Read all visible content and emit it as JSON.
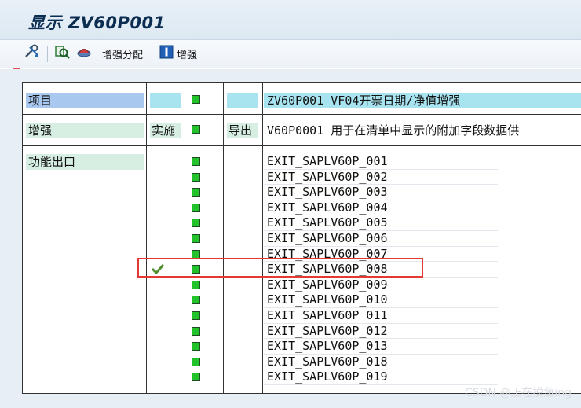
{
  "window": {
    "title": "显示 ZV60P001"
  },
  "toolbar": {
    "items": [
      {
        "icon": "config-tools-icon"
      },
      {
        "icon": "where-used-icon"
      },
      {
        "icon": "transport-icon"
      },
      {
        "label": "增强分配",
        "icon": ""
      },
      {
        "label": "增强",
        "icon": "info-icon"
      }
    ]
  },
  "grid": {
    "row1": {
      "label": "项目",
      "desc": "ZV60P001 VF04开票日期/净值增强"
    },
    "row2": {
      "label": "增强",
      "impl": "实施",
      "export": "导出",
      "desc": "V60P0001 用于在清单中显示的附加字段数据供"
    },
    "row3": {
      "label": "功能出口"
    }
  },
  "exits": [
    "EXIT_SAPLV60P_001",
    "EXIT_SAPLV60P_002",
    "EXIT_SAPLV60P_003",
    "EXIT_SAPLV60P_004",
    "EXIT_SAPLV60P_005",
    "EXIT_SAPLV60P_006",
    "EXIT_SAPLV60P_007",
    "EXIT_SAPLV60P_008",
    "EXIT_SAPLV60P_009",
    "EXIT_SAPLV60P_010",
    "EXIT_SAPLV60P_011",
    "EXIT_SAPLV60P_012",
    "EXIT_SAPLV60P_013",
    "EXIT_SAPLV60P_018",
    "EXIT_SAPLV60P_019"
  ],
  "highlighted_exit": "EXIT_SAPLV60P_008",
  "colors": {
    "status_active": "#22c22a",
    "highlight_border": "#e53935",
    "label_blue": "#a8c8f0",
    "label_cyan": "#a8e4f0"
  },
  "watermark": "CSDN @正在摸鱼ing"
}
